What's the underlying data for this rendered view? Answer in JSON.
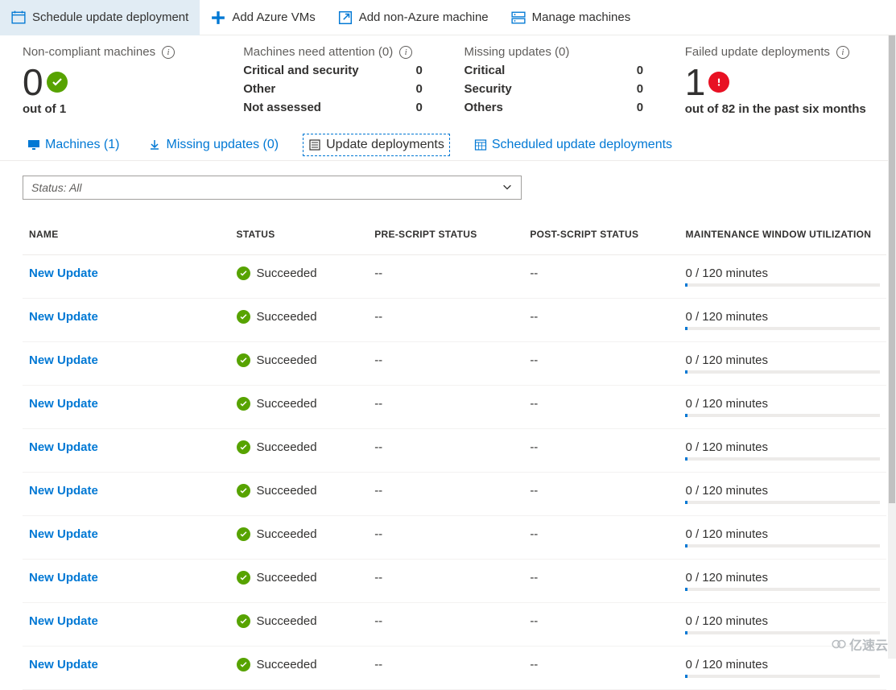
{
  "toolbar": {
    "schedule": "Schedule update deployment",
    "addAzure": "Add Azure VMs",
    "addNonAzure": "Add non-Azure machine",
    "manage": "Manage machines"
  },
  "summary": {
    "nonCompliant": {
      "label": "Non-compliant machines",
      "count": "0",
      "sub": "out of 1"
    },
    "needAttention": {
      "label": "Machines need attention (0)",
      "rows": [
        {
          "label": "Critical and security",
          "val": "0"
        },
        {
          "label": "Other",
          "val": "0"
        },
        {
          "label": "Not assessed",
          "val": "0"
        }
      ]
    },
    "missing": {
      "label": "Missing updates (0)",
      "rows": [
        {
          "label": "Critical",
          "val": "0"
        },
        {
          "label": "Security",
          "val": "0"
        },
        {
          "label": "Others",
          "val": "0"
        }
      ]
    },
    "failed": {
      "label": "Failed update deployments",
      "count": "1",
      "sub": "out of 82 in the past six months"
    }
  },
  "tabs": {
    "machines": "Machines (1)",
    "missing": "Missing updates (0)",
    "deployments": "Update deployments",
    "scheduled": "Scheduled update deployments"
  },
  "filter": {
    "status": "Status: All"
  },
  "table": {
    "headers": {
      "name": "NAME",
      "status": "STATUS",
      "pre": "PRE-SCRIPT STATUS",
      "post": "POST-SCRIPT STATUS",
      "maint": "MAINTENANCE WINDOW UTILIZATION"
    },
    "rows": [
      {
        "name": "New Update",
        "status": "Succeeded",
        "pre": "--",
        "post": "--",
        "maint": "0 / 120 minutes"
      },
      {
        "name": "New Update",
        "status": "Succeeded",
        "pre": "--",
        "post": "--",
        "maint": "0 / 120 minutes"
      },
      {
        "name": "New Update",
        "status": "Succeeded",
        "pre": "--",
        "post": "--",
        "maint": "0 / 120 minutes"
      },
      {
        "name": "New Update",
        "status": "Succeeded",
        "pre": "--",
        "post": "--",
        "maint": "0 / 120 minutes"
      },
      {
        "name": "New Update",
        "status": "Succeeded",
        "pre": "--",
        "post": "--",
        "maint": "0 / 120 minutes"
      },
      {
        "name": "New Update",
        "status": "Succeeded",
        "pre": "--",
        "post": "--",
        "maint": "0 / 120 minutes"
      },
      {
        "name": "New Update",
        "status": "Succeeded",
        "pre": "--",
        "post": "--",
        "maint": "0 / 120 minutes"
      },
      {
        "name": "New Update",
        "status": "Succeeded",
        "pre": "--",
        "post": "--",
        "maint": "0 / 120 minutes"
      },
      {
        "name": "New Update",
        "status": "Succeeded",
        "pre": "--",
        "post": "--",
        "maint": "0 / 120 minutes"
      },
      {
        "name": "New Update",
        "status": "Succeeded",
        "pre": "--",
        "post": "--",
        "maint": "0 / 120 minutes"
      }
    ]
  },
  "watermark": "亿速云"
}
